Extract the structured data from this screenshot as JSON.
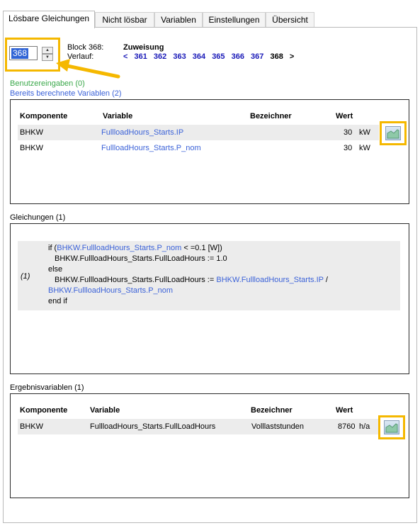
{
  "tabs": [
    {
      "label": "Lösbare Gleichungen",
      "active": true
    },
    {
      "label": "Nicht lösbar",
      "active": false
    },
    {
      "label": "Variablen",
      "active": false
    },
    {
      "label": "Einstellungen",
      "active": false
    },
    {
      "label": "Übersicht",
      "active": false
    }
  ],
  "block": {
    "spinner_value": "368",
    "block_label": "Block 368:",
    "verlauf_label": "Verlauf:",
    "type": "Zuweisung",
    "history_prev_arrow": "<",
    "history": [
      "361",
      "362",
      "363",
      "364",
      "365",
      "366",
      "367"
    ],
    "history_current": "368",
    "history_next_arrow": ">"
  },
  "links": {
    "user_inputs": "Benutzereingaben (0)",
    "computed_vars": "Bereits berechnete Variablen (2)"
  },
  "colors": {
    "user_inputs": "#3aa84a",
    "computed_vars": "#3b62d8",
    "highlight": "#f5b800",
    "arrow": "#f5b800"
  },
  "computed_table": {
    "headers": {
      "component": "Komponente",
      "variable": "Variable",
      "name": "Bezeichner",
      "value": "Wert"
    },
    "rows": [
      {
        "component": "BHKW",
        "variable": "FullloadHours_Starts.IP",
        "name": "",
        "value": "30",
        "unit": "kW"
      },
      {
        "component": "BHKW",
        "variable": "FullloadHours_Starts.P_nom",
        "name": "",
        "value": "30",
        "unit": "kW"
      }
    ]
  },
  "equations": {
    "title": "Gleichungen (1)",
    "number": "(1)",
    "lines": {
      "l1_a": "if (",
      "l1_link": "BHKW.FullloadHours_Starts.P_nom",
      "l1_b": " < =0.1 [W])",
      "l2": "BHKW.FullloadHours_Starts.FullLoadHours := 1.0",
      "l3": "else",
      "l4_a": "BHKW.FullloadHours_Starts.FullLoadHours := ",
      "l4_link": "BHKW.FullloadHours_Starts.IP",
      "l4_b": " /",
      "l5_link": "BHKW.FullloadHours_Starts.P_nom",
      "l6": "end if"
    }
  },
  "results": {
    "title": "Ergebnisvariablen (1)",
    "headers": {
      "component": "Komponente",
      "variable": "Variable",
      "name": "Bezeichner",
      "value": "Wert"
    },
    "rows": [
      {
        "component": "BHKW",
        "variable": "FullloadHours_Starts.FullLoadHours",
        "name": "Volllaststunden",
        "value": "8760",
        "unit": "h/a"
      }
    ]
  },
  "icons": {
    "plot_button": "chart-icon",
    "spin_up": "chevron-up-icon",
    "spin_down": "chevron-down-icon",
    "annotation_arrow": "arrow-icon"
  }
}
